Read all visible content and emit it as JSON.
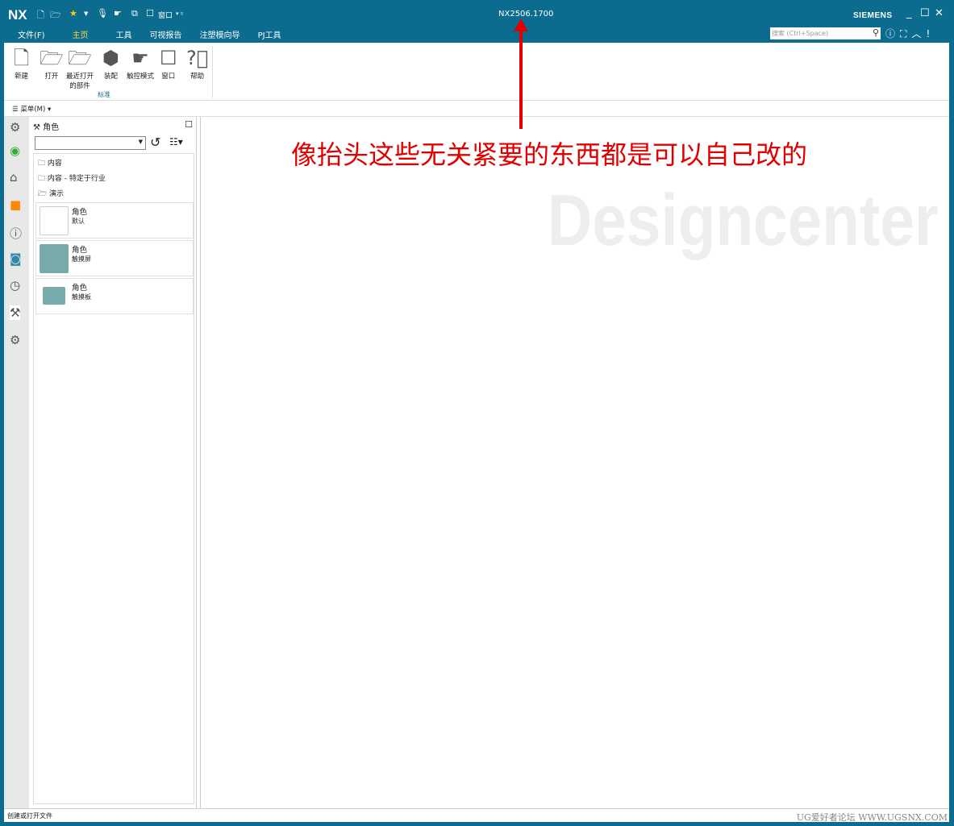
{
  "app": {
    "logo": "NX",
    "title": "NX2506.1700",
    "brand": "SIEMENS",
    "quick_window": "窗口"
  },
  "tabs": [
    "文件(F)",
    "主页",
    "工具",
    "可视报告",
    "注塑模向导",
    "PJ工具"
  ],
  "search": {
    "placeholder": "搜索 (Ctrl+Space)"
  },
  "ribbon": {
    "buttons": [
      "新建",
      "打开",
      "最近打开的部件",
      "装配",
      "触控模式",
      "窗口",
      "帮助"
    ],
    "group": "标准"
  },
  "menu": {
    "label": "菜单(M)"
  },
  "panel": {
    "title": "角色",
    "folders": [
      "内容",
      "内容 - 特定于行业",
      "演示"
    ],
    "cards": [
      {
        "title": "角色",
        "sub": "默认"
      },
      {
        "title": "角色",
        "sub": "触摸屏"
      },
      {
        "title": "角色",
        "sub": "触摸板"
      }
    ]
  },
  "annotation": "像抬头这些无关紧要的东西都是可以自己改的",
  "watermark": "Designcenter",
  "status": {
    "text": "创建或打开文件",
    "forum": "UG爱好者论坛 WWW.UGSNX.COM"
  }
}
